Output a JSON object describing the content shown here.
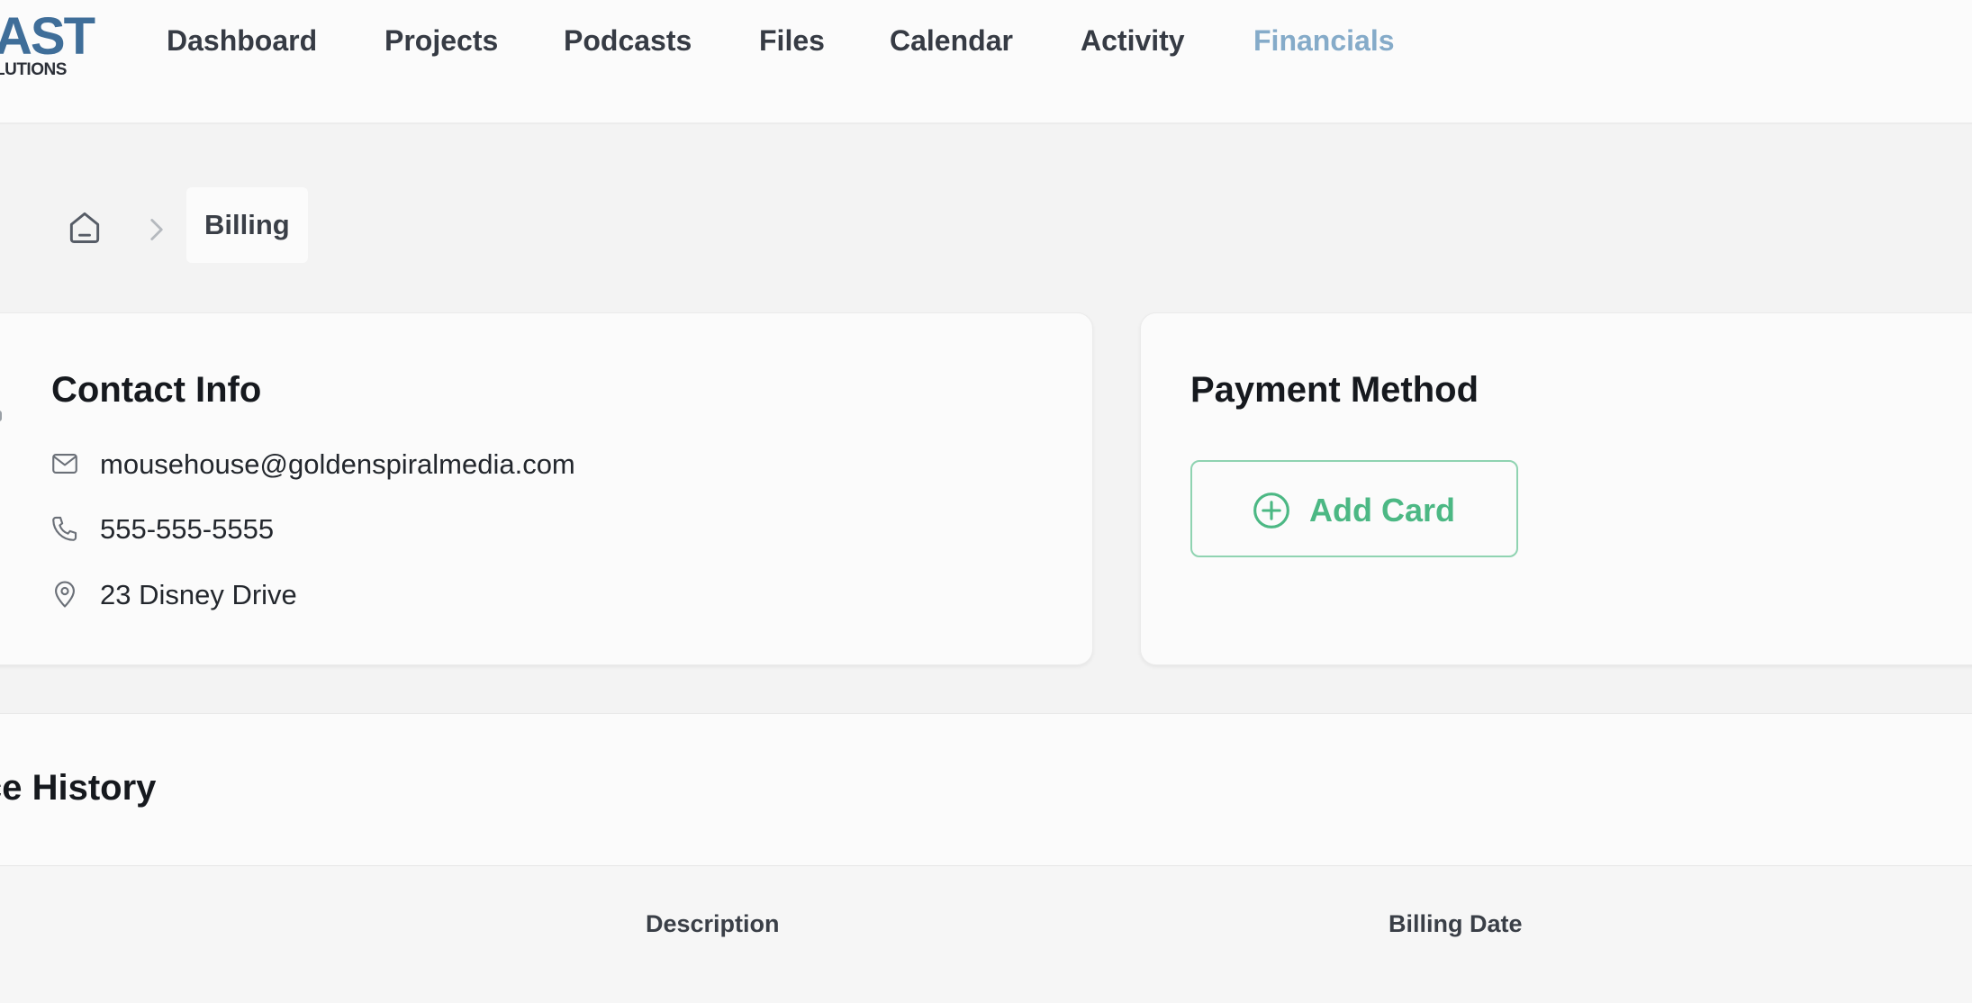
{
  "brand": {
    "line1": "AST",
    "line2": "LUTIONS",
    "color": "#3f6e99"
  },
  "nav": {
    "items": [
      {
        "label": "Dashboard"
      },
      {
        "label": "Projects"
      },
      {
        "label": "Podcasts"
      },
      {
        "label": "Files"
      },
      {
        "label": "Calendar"
      },
      {
        "label": "Activity"
      },
      {
        "label": "Financials"
      }
    ],
    "active": "Financials",
    "active_color": "#85abc9"
  },
  "breadcrumb": {
    "home_icon": "home-icon",
    "separator_icon": "chevron-right-icon",
    "current": "Billing"
  },
  "contact": {
    "title": "Contact Info",
    "email": "mousehouse@goldenspiralmedia.com",
    "phone": "555-555-5555",
    "address": "23 Disney Drive",
    "icons": [
      "mail-icon",
      "phone-icon",
      "map-pin-icon"
    ]
  },
  "payment": {
    "title": "Payment Method",
    "add_card_label": "Add Card",
    "add_card_icon": "plus-circle-icon",
    "accent": "#4cb884"
  },
  "invoices": {
    "title": "ce History",
    "columns": [
      {
        "label": "Description"
      },
      {
        "label": "Billing Date"
      }
    ]
  }
}
